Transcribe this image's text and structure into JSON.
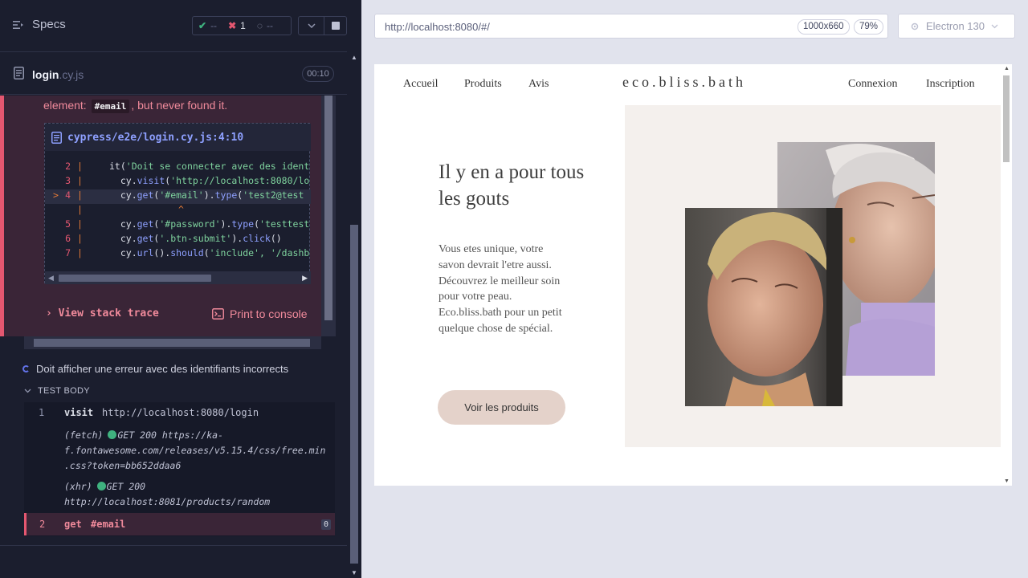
{
  "runner": {
    "specs_label": "Specs",
    "stats": {
      "passed": "--",
      "failed": "1",
      "pending": "--"
    },
    "spec_file": {
      "name": "login",
      "ext": ".cy.js",
      "duration": "00:10"
    },
    "error": {
      "msg_prefix": "element:",
      "selector": "#email",
      "msg_suffix": ", but never found it.",
      "frame_path": "cypress/e2e/login.cy.js:4:10",
      "view_stack_trace": "View stack trace",
      "print_to_console": "Print to console"
    },
    "code_lines": [
      {
        "num": "2",
        "pre": "it(",
        "str1": "'Doit se connecter avec des ident",
        "rest": ""
      },
      {
        "num": "3",
        "pre": "  cy.",
        "method": "visit",
        "mid": "(",
        "str1": "'http://localhost:8080/lo",
        "rest": ""
      },
      {
        "num": "4",
        "pre": "  cy.",
        "method": "get",
        "mid": "(",
        "str1": "'#email'",
        "mid2": ").",
        "method2": "type",
        "mid3": "(",
        "str2": "'test2@test",
        "rest": ""
      },
      {
        "num": "",
        "caret": "^"
      },
      {
        "num": "5",
        "pre": "  cy.",
        "method": "get",
        "mid": "(",
        "str1": "'#password'",
        "mid2": ").",
        "method2": "type",
        "mid3": "(",
        "str2": "'testtest",
        "rest": ""
      },
      {
        "num": "6",
        "pre": "  cy.",
        "method": "get",
        "mid": "(",
        "str1": "'.btn-submit'",
        "mid2": ").",
        "method2": "click",
        "mid3": "()",
        "str2": "",
        "rest": ""
      },
      {
        "num": "7",
        "pre": "  cy.",
        "method": "url",
        "mid": "().",
        "str1": "",
        "method2": "should",
        "mid3": "(",
        "str2": "'include', '/dashb",
        "rest": ""
      }
    ],
    "test2_title": "Doit afficher une erreur avec des identifiants incorrects",
    "test_body_label": "TEST BODY",
    "commands": {
      "visit": {
        "num": "1",
        "name": "visit",
        "msg": "http://localhost:8080/login"
      },
      "fetch": {
        "type": "(fetch)",
        "status": "GET 200",
        "url_line1": "https://ka-",
        "url_line2": "f.fontawesome.com/releases/v5.15.4/css/free.min",
        "url_line3": ".css?token=bb652ddaa6"
      },
      "xhr": {
        "type": "(xhr)",
        "status": "GET 200",
        "url": "http://localhost:8081/products/random"
      },
      "get": {
        "num": "2",
        "name": "get",
        "msg": "#email",
        "count": "0"
      }
    }
  },
  "browser": {
    "url": "http://localhost:8080/#/",
    "viewport": "1000x660",
    "zoom": "79%",
    "browser_name": "Electron 130"
  },
  "site": {
    "nav_left": [
      "Accueil",
      "Produits",
      "Avis"
    ],
    "logo": "eco.bliss.bath",
    "nav_right": [
      "Connexion",
      "Inscription"
    ],
    "hero_title": "Il y en a pour tous les gouts",
    "hero_text": "Vous etes unique, votre savon devrait l'etre aussi. Découvrez le meilleur soin pour votre peau. Eco.bliss.bath pour un petit quelque chose de spécial.",
    "hero_button": "Voir les produits"
  },
  "colors": {
    "accent_fail": "#e45770",
    "accent_pass": "#3fb27f",
    "accent_link": "#8ea0ff",
    "hero_bg": "#f4f0ed",
    "button_bg": "#e4d2ca"
  }
}
